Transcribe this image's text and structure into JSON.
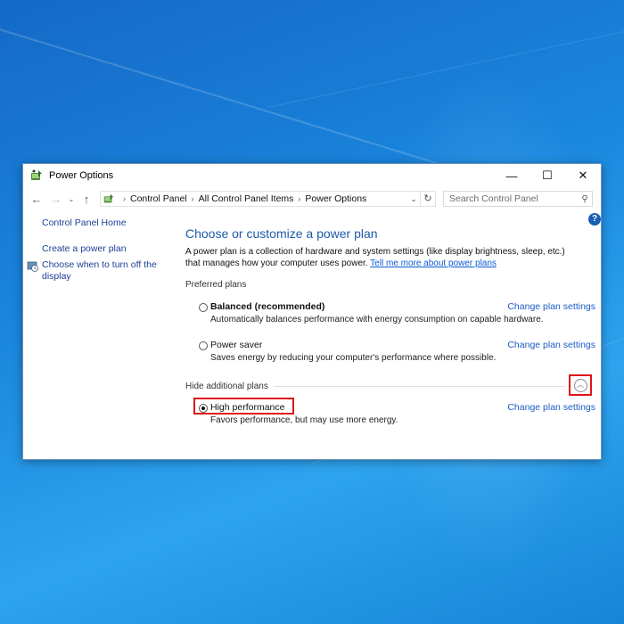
{
  "window": {
    "title": "Power Options",
    "minimize": "—",
    "maximize": "☐",
    "close": "✕"
  },
  "address": {
    "crumbs": [
      "Control Panel",
      "All Control Panel Items",
      "Power Options"
    ],
    "separator": "›",
    "dropdown": "⌄",
    "refresh": "↻"
  },
  "search": {
    "placeholder": "Search Control Panel"
  },
  "help": "?",
  "sidebar": {
    "home": "Control Panel Home",
    "items": [
      {
        "label": "Create a power plan"
      },
      {
        "label": "Choose when to turn off the display"
      }
    ]
  },
  "main": {
    "heading": "Choose or customize a power plan",
    "description": "A power plan is a collection of hardware and system settings (like display brightness, sleep, etc.) that manages how your computer uses power.",
    "learn_more": "Tell me more about power plans",
    "preferred_label": "Preferred plans",
    "additional_label": "Hide additional plans",
    "change_label": "Change plan settings",
    "plans": [
      {
        "name": "Balanced (recommended)",
        "description": "Automatically balances performance with energy consumption on capable hardware.",
        "selected": false
      },
      {
        "name": "Power saver",
        "description": "Saves energy by reducing your computer's performance where possible.",
        "selected": false
      },
      {
        "name": "High performance",
        "description": "Favors performance, but may use more energy.",
        "selected": true
      }
    ]
  }
}
